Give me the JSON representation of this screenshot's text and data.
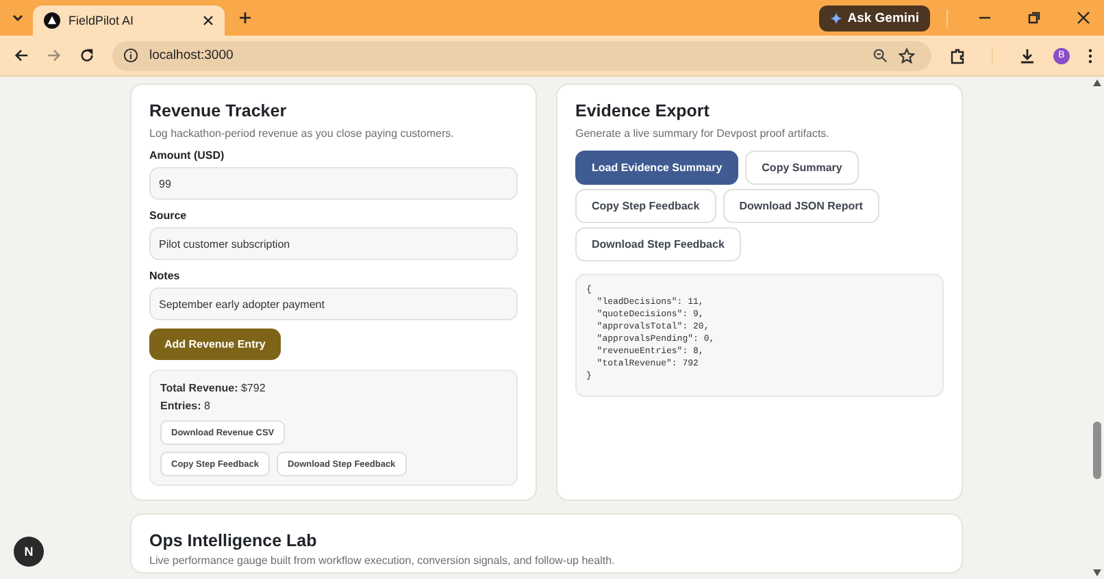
{
  "browser": {
    "tab": {
      "title": "FieldPilot AI",
      "selected": true
    },
    "ask_button": "Ask Gemini",
    "address": "localhost:3000",
    "forward_disabled": true,
    "avatar": "B"
  },
  "revenue_tracker": {
    "title": "Revenue Tracker",
    "subtitle": "Log hackathon-period revenue as you close paying customers.",
    "fields": [
      {
        "label": "Amount (USD)",
        "value": "99"
      },
      {
        "label": "Source",
        "value": "Pilot customer subscription"
      },
      {
        "label": "Notes",
        "value": "September early adopter payment"
      }
    ],
    "submit": "Add Revenue Entry",
    "summary_lines": [
      "**Total Revenue:** $792",
      "**Entries:** 8"
    ],
    "summary_buttons": [
      [
        "Download Revenue CSV"
      ],
      [
        "Copy Step Feedback",
        "Download Step Feedback"
      ]
    ]
  },
  "evidence_export": {
    "title": "Evidence Export",
    "subtitle": "Generate a live summary for Devpost proof artifacts.",
    "buttons": [
      {
        "label": "Load Evidence Summary",
        "kind": "primary"
      },
      {
        "label": "Copy Summary",
        "kind": "secondary"
      },
      {
        "label": "Copy Step Feedback",
        "kind": "secondary"
      },
      {
        "label": "Download JSON Report",
        "kind": "secondary"
      },
      {
        "label": "Download Step Feedback",
        "kind": "secondary"
      }
    ],
    "report_lines": [
      "{",
      "  \"leadDecisions\": 11,",
      "  \"quoteDecisions\": 9,",
      "  \"approvalsTotal\": 20,",
      "  \"approvalsPending\": 0,",
      "  \"revenueEntries\": 8,",
      "  \"totalRevenue\": 792",
      "}"
    ]
  },
  "ops_lab": {
    "title": "Ops Intelligence Lab",
    "subtitle": "Live performance gauge built from workflow execution, conversion signals, and follow-up health."
  },
  "dev_badge": "N"
}
